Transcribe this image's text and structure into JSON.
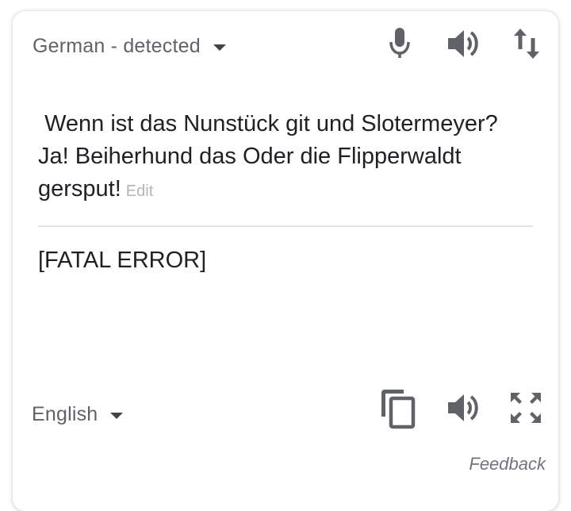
{
  "source": {
    "language_label": "German - detected",
    "text": " Wenn ist das Nunstück git und Slotermeyer? Ja! Beiherhund das Oder die Flipperwaldt gersput!",
    "edit_label": "Edit"
  },
  "target": {
    "language_label": "English",
    "text": "[FATAL ERROR]"
  },
  "feedback_label": "Feedback",
  "icons": {
    "source_toolbar": [
      "microphone-icon",
      "speaker-icon",
      "swap-languages-icon"
    ],
    "target_toolbar": [
      "copy-icon",
      "speaker-icon",
      "fullscreen-icon"
    ]
  },
  "colors": {
    "icon": "#5f6368",
    "text": "#202124",
    "secondary_text": "#70757a",
    "edit_link": "#b5b5b5",
    "divider": "#e3e3e3"
  }
}
